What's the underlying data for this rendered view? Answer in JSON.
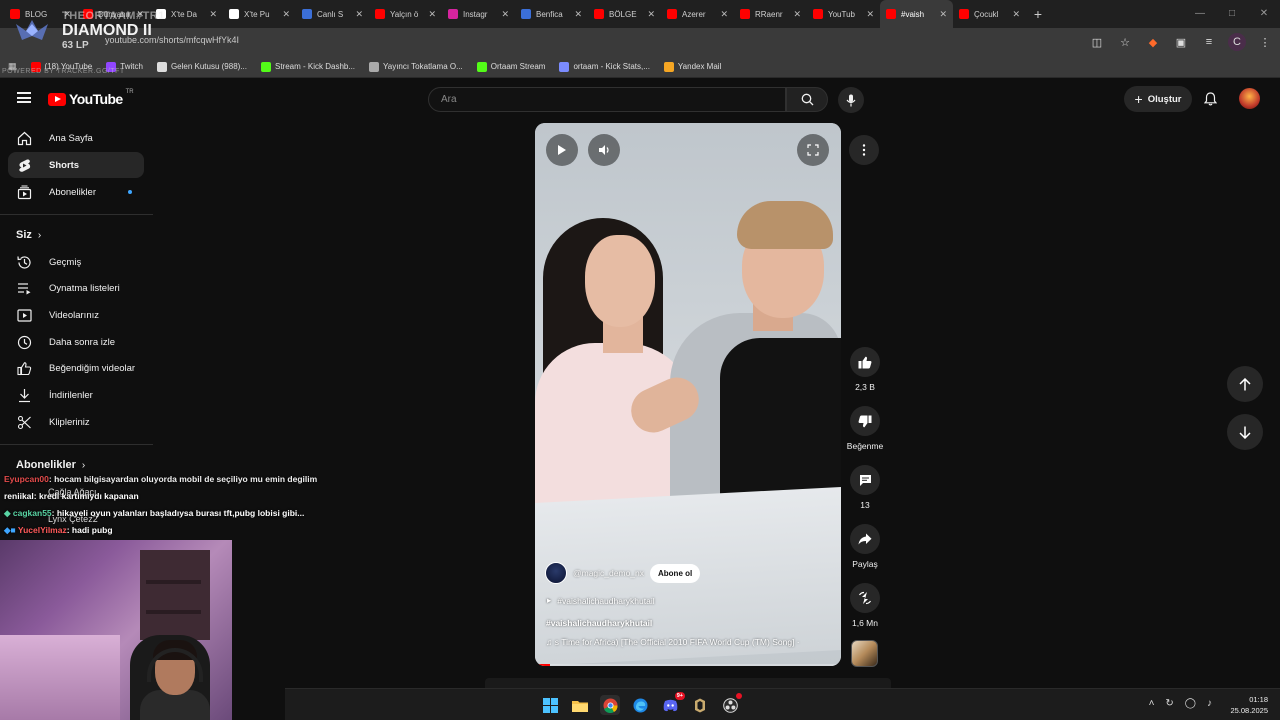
{
  "browser": {
    "tabs": [
      {
        "label": "BLOG",
        "color": "#ff0000"
      },
      {
        "label": "Dünyanın",
        "color": "#ff0000"
      },
      {
        "label": "X'te Da",
        "color": "#ffffff"
      },
      {
        "label": "X'te Pu",
        "color": "#ffffff"
      },
      {
        "label": "Canlı S",
        "color": "#3b6fd8"
      },
      {
        "label": "Yalçın ö",
        "color": "#ff0000"
      },
      {
        "label": "Instagr",
        "color": "#d6249f"
      },
      {
        "label": "Benfica",
        "color": "#3b6fd8"
      },
      {
        "label": "BÖLGE",
        "color": "#ff0000"
      },
      {
        "label": "Azerer",
        "color": "#ff0000"
      },
      {
        "label": "RRaenr",
        "color": "#ff0000"
      },
      {
        "label": "YouTub",
        "color": "#ff0000"
      },
      {
        "label": "#vaish",
        "color": "#ff0000"
      },
      {
        "label": "Çocukl",
        "color": "#ff0000"
      }
    ],
    "url": "youtube.com/shorts/mfcqwHfYk4I",
    "bookmarks": [
      {
        "label": "(18) YouTube",
        "color": "#ff0000"
      },
      {
        "label": "Twitch",
        "color": "#9146ff"
      },
      {
        "label": "Gelen Kutusu (988)...",
        "color": "#dddddd"
      },
      {
        "label": "Stream - Kick Dashb...",
        "color": "#53fc18"
      },
      {
        "label": "Yayıncı Tokatlama O...",
        "color": "#aaaaaa"
      },
      {
        "label": "Ortaam Stream",
        "color": "#53fc18"
      },
      {
        "label": "ortaam - Kick Stats,...",
        "color": "#7b8cff"
      },
      {
        "label": "Yandex Mail",
        "color": "#f5a623"
      }
    ],
    "profile_initial": "C"
  },
  "overlay": {
    "summoner": "THEORTAAM#TR1",
    "region": "TR",
    "rank": "DIAMOND II",
    "lp": "63 LP",
    "powered": "POWERED BY TRACKER.GG/TFT"
  },
  "youtube": {
    "region_code": "TR",
    "logo_text": "YouTube",
    "search_placeholder": "Ara",
    "create_label": "Oluştur",
    "sidebar": {
      "items": [
        {
          "label": "Ana Sayfa",
          "icon": "home-icon"
        },
        {
          "label": "Shorts",
          "icon": "shorts-icon"
        },
        {
          "label": "Abonelikler",
          "icon": "subscriptions-icon"
        }
      ],
      "you_header": "Siz",
      "you_items": [
        {
          "label": "Geçmiş",
          "icon": "history-icon"
        },
        {
          "label": "Oynatma listeleri",
          "icon": "playlists-icon"
        },
        {
          "label": "Videolarınız",
          "icon": "your-videos-icon"
        },
        {
          "label": "Daha sonra izle",
          "icon": "watch-later-icon"
        },
        {
          "label": "Beğendiğim videolar",
          "icon": "liked-icon"
        },
        {
          "label": "İndirilenler",
          "icon": "downloads-icon"
        },
        {
          "label": "Klipleriniz",
          "icon": "clips-icon"
        }
      ],
      "subs_header": "Abonelikler",
      "subs": [
        "Çağla Ağacı",
        "Lynx Çetez2"
      ]
    },
    "short": {
      "channel": "@magic_demo_nx",
      "subscribe": "Abone ol",
      "tag_line": "#vaishalichaudharykhutail",
      "title": "#vaishalichaudharykhutail",
      "song": "s Time for Africa) [The Official 2010 FIFA World Cup (TM) Song] ·",
      "progress": 0.05
    },
    "actions": {
      "likes": "2,3 B",
      "dislike": "Beğenme",
      "comments": "13",
      "share": "Paylaş",
      "remix": "1,6 Mn"
    }
  },
  "chat": [
    {
      "user": "Eyupcan00",
      "msg": ": hocam bilgisayardan oluyorda mobil de seçiliyo mu emin degilim"
    },
    {
      "user": "reniikal",
      "msg": ": kredi kartımıydı kapanan"
    },
    {
      "user": "cagkan55",
      "msg": ": hikayeli oyun yalanları başladıysa burası tft,pubg lobisi gibi..."
    },
    {
      "user": "YucelYilmaz",
      "msg": ": hadi pubg"
    }
  ],
  "taskbar": {
    "time": "01:18",
    "date": "25.08.2025",
    "discord_badge": "9+"
  }
}
